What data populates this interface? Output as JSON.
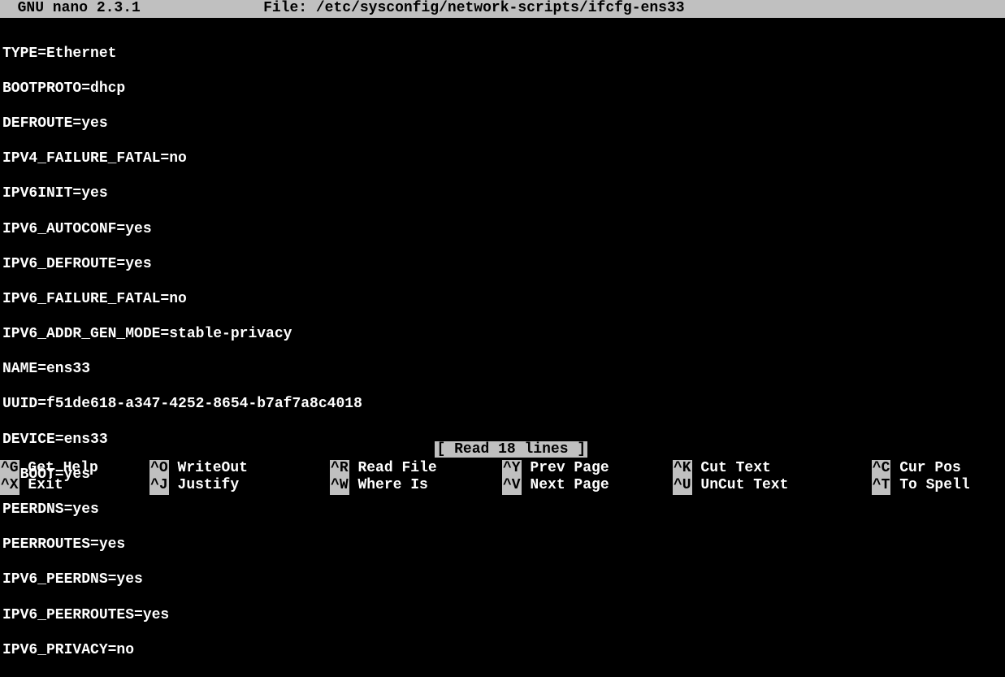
{
  "title_bar": {
    "app": "  GNU nano 2.3.1",
    "file_label": "File: /etc/sysconfig/network-scripts/ifcfg-ens33"
  },
  "file_lines": [
    "TYPE=Ethernet",
    "BOOTPROTO=dhcp",
    "DEFROUTE=yes",
    "IPV4_FAILURE_FATAL=no",
    "IPV6INIT=yes",
    "IPV6_AUTOCONF=yes",
    "IPV6_DEFROUTE=yes",
    "IPV6_FAILURE_FATAL=no",
    "IPV6_ADDR_GEN_MODE=stable-privacy",
    "NAME=ens33",
    "UUID=f51de618-a347-4252-8654-b7af7a8c4018",
    "DEVICE=ens33",
    "ONBOOT=yes",
    "PEERDNS=yes",
    "PEERROUTES=yes",
    "IPV6_PEERDNS=yes",
    "IPV6_PEERROUTES=yes",
    "IPV6_PRIVACY=no"
  ],
  "status": "[ Read 18 lines ]",
  "shortcuts_row1": [
    {
      "key": "^G",
      "label": " Get Help"
    },
    {
      "key": "^O",
      "label": " WriteOut"
    },
    {
      "key": "^R",
      "label": " Read File"
    },
    {
      "key": "^Y",
      "label": " Prev Page"
    },
    {
      "key": "^K",
      "label": " Cut Text"
    },
    {
      "key": "^C",
      "label": " Cur Pos"
    }
  ],
  "shortcuts_row2": [
    {
      "key": "^X",
      "label": " Exit"
    },
    {
      "key": "^J",
      "label": " Justify"
    },
    {
      "key": "^W",
      "label": " Where Is"
    },
    {
      "key": "^V",
      "label": " Next Page"
    },
    {
      "key": "^U",
      "label": " UnCut Text"
    },
    {
      "key": "^T",
      "label": " To Spell"
    }
  ]
}
